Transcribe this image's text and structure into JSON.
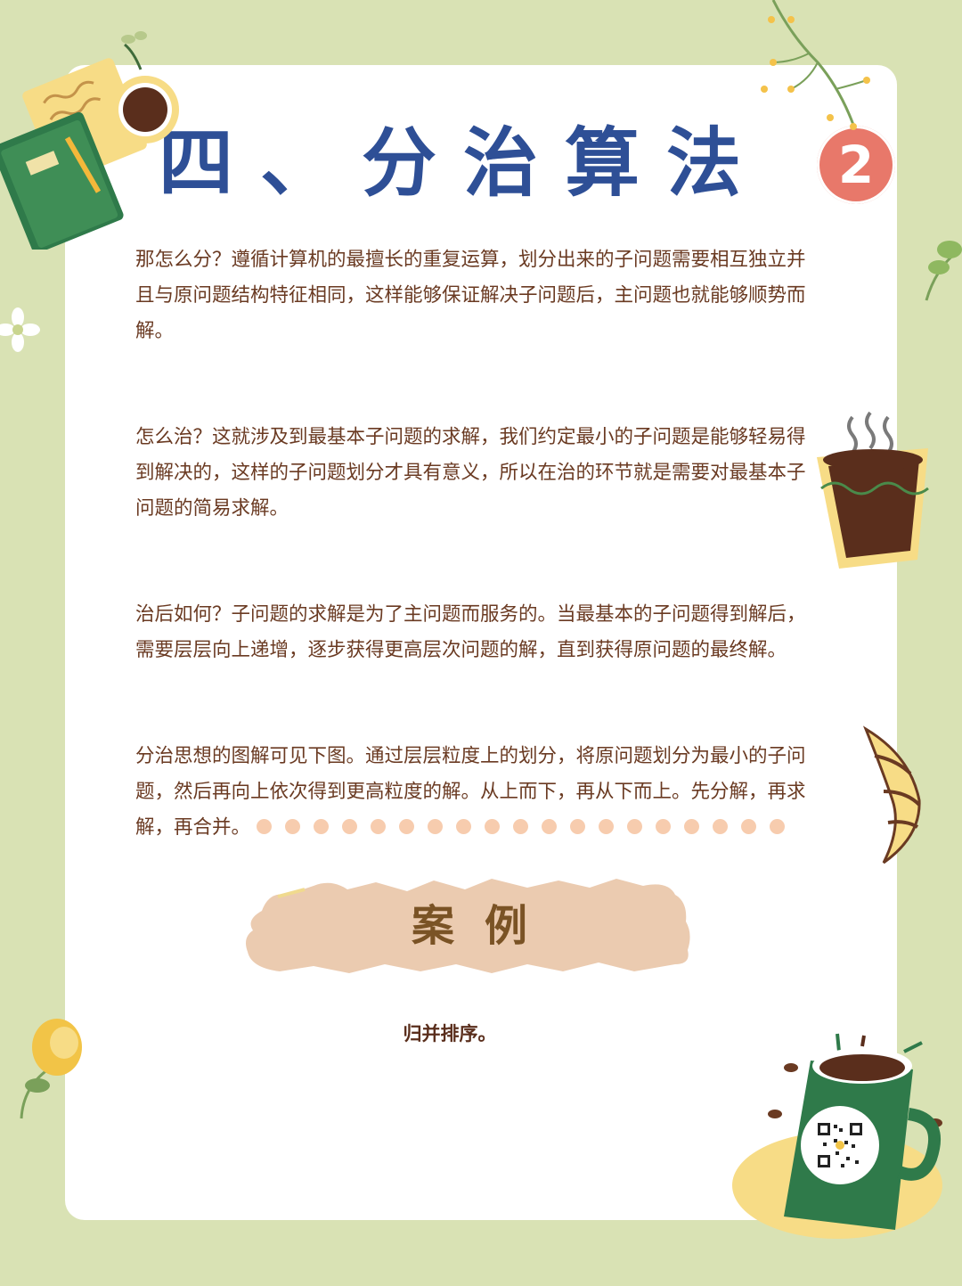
{
  "title": "四、分治算法",
  "badge": "2",
  "paragraphs": [
    "那怎么分？遵循计算机的最擅长的重复运算，划分出来的子问题需要相互独立并且与原问题结构特征相同，这样能够保证解决子问题后，主问题也就能够顺势而解。",
    "怎么治？这就涉及到最基本子问题的求解，我们约定最小的子问题是能够轻易得到解决的，这样的子问题划分才具有意义，所以在治的环节就是需要对最基本子问题的简易求解。",
    "治后如何？子问题的求解是为了主问题而服务的。当最基本的子问题得到解后，需要层层向上递增，逐步获得更高层次问题的解，直到获得原问题的最终解。",
    "分治思想的图解可见下图。通过层层粒度上的划分，将原问题划分为最小的子问题，然后再向上依次得到更高粒度的解。从上而下，再从下而上。先分解，再求解，再合并。"
  ],
  "case_label": "案例",
  "example": "归并排序。",
  "colors": {
    "background": "#d9e2b4",
    "paper": "#ffffff",
    "title": "#2e4f96",
    "badge": "#e8786a",
    "body_text": "#6a3a22",
    "dots": "#f7ccae",
    "case_box": "#ebcbb0",
    "case_text": "#7a5325"
  },
  "decorations": [
    "notebook-icon",
    "coffee-cup-icon",
    "flower-branch-icon",
    "daisy-icon",
    "leaf-icon",
    "coffee-pot-icon",
    "croissant-icon",
    "lemon-flower-icon",
    "coffee-mug-icon",
    "qr-code-icon"
  ]
}
